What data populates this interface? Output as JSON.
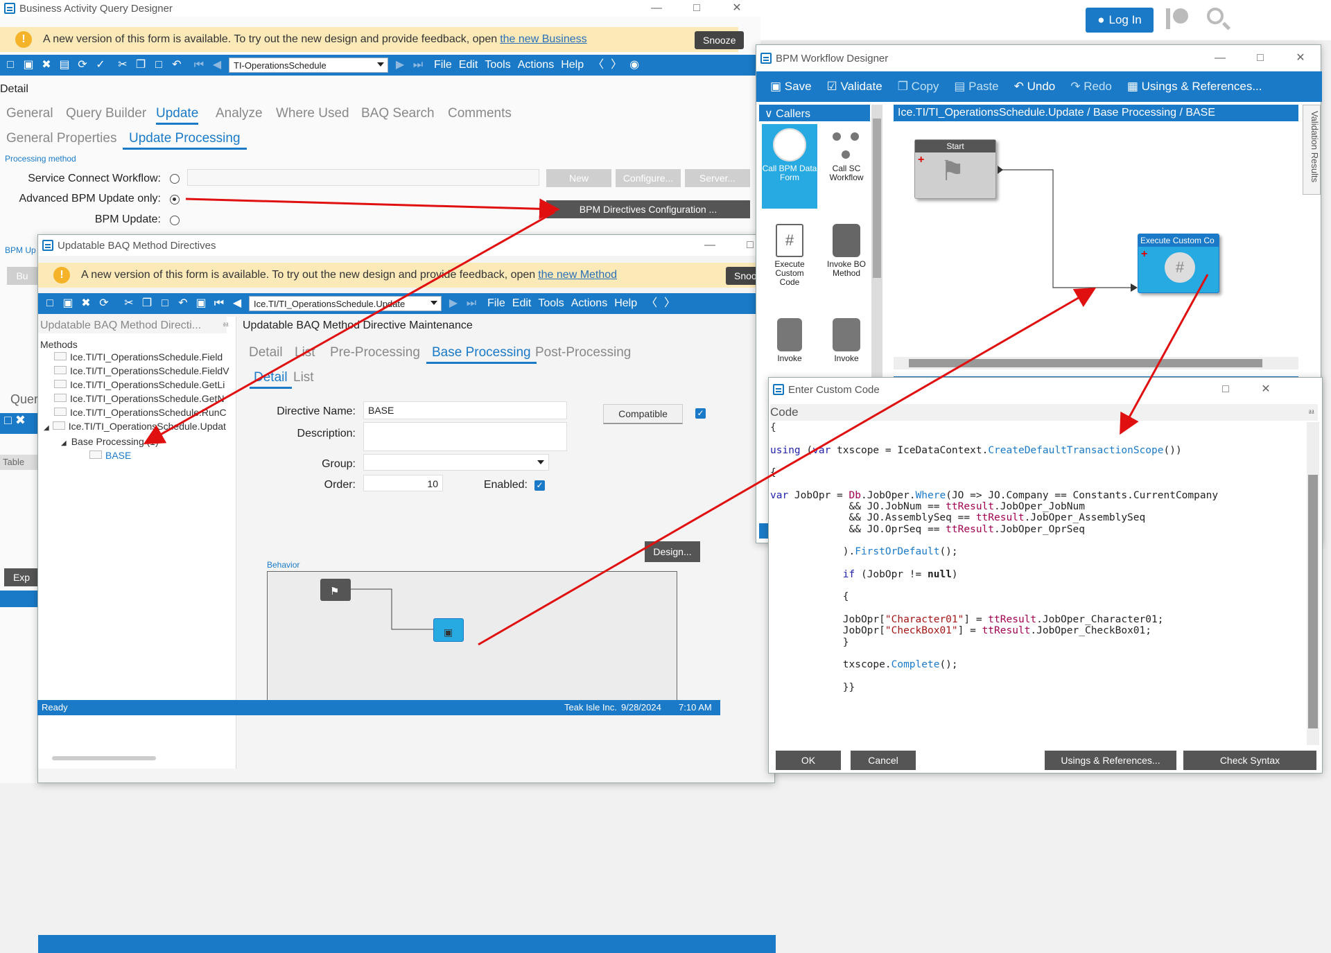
{
  "browser": {
    "login_label": "Log In"
  },
  "baq_designer": {
    "title": "Business Activity Query Designer",
    "banner_text": "A new version of this form is available. To try out the new design and provide feedback, open ",
    "banner_link": "the new Business",
    "snooze_label": "Snooze",
    "combo_value": "TI-OperationsSchedule",
    "menus": [
      "File",
      "Edit",
      "Tools",
      "Actions",
      "Help"
    ],
    "detail_label": "Detail",
    "tabs": [
      "General",
      "Query Builder",
      "Update",
      "Analyze",
      "Where Used",
      "BAQ Search",
      "Comments"
    ],
    "subtabs": [
      "General Properties",
      "Update Processing"
    ],
    "processing_method_label": "Processing method",
    "service_connect_label": "Service Connect Workflow:",
    "advanced_bpm_label": "Advanced BPM Update only:",
    "bpm_update_label": "BPM Update:",
    "new_btn": "New",
    "configure_btn": "Configure...",
    "server_btn": "Server...",
    "bpm_directives_btn": "BPM Directives Configuration ...",
    "bpm_up_label": "BPM Up",
    "bu_btn": "Bu",
    "query_label": "Quer",
    "table_label": "Table",
    "exp_btn": "Exp"
  },
  "directives": {
    "title": "Updatable BAQ Method Directives",
    "banner_text": "A new version of this form is available. To try out the new design and provide feedback, open ",
    "banner_link": "the new Method",
    "snooze_label": "Snoo",
    "combo_value": "Ice.TI/TI_OperationsSchedule.Update",
    "menus": [
      "File",
      "Edit",
      "Tools",
      "Actions",
      "Help"
    ],
    "left_header": "Updatable BAQ Method Directi...",
    "right_header": "Updatable BAQ Method Directive Maintenance",
    "methods_label": "Methods",
    "methods": [
      "Ice.TI/TI_OperationsSchedule.Field",
      "Ice.TI/TI_OperationsSchedule.FieldV",
      "Ice.TI/TI_OperationsSchedule.GetLi",
      "Ice.TI/TI_OperationsSchedule.GetN",
      "Ice.TI/TI_OperationsSchedule.RunC",
      "Ice.TI/TI_OperationsSchedule.Updat"
    ],
    "base_processing_node": "Base Processing (1)",
    "base_node": "BASE",
    "tabs": [
      "Detail",
      "List",
      "Pre-Processing",
      "Base Processing",
      "Post-Processing"
    ],
    "subtabs": [
      "Detail",
      "List"
    ],
    "directive_name_label": "Directive Name:",
    "directive_name_value": "BASE",
    "description_label": "Description:",
    "group_label": "Group:",
    "order_label": "Order:",
    "order_value": "10",
    "enabled_label": "Enabled:",
    "compatible_label": "Compatible",
    "behavior_label": "Behavior",
    "design_btn": "Design...",
    "status_ready": "Ready",
    "status_company": "Teak Isle Inc.",
    "status_date": "9/28/2024",
    "status_time": "7:10 AM"
  },
  "bpm_workflow": {
    "title": "BPM Workflow Designer",
    "toolbar": [
      "Save",
      "Validate",
      "Copy",
      "Paste",
      "Undo",
      "Redo",
      "Usings & References..."
    ],
    "callers_label": "Callers",
    "palette": [
      "Call BPM Data Form",
      "Call SC Workflow",
      "Execute Custom Code",
      "Invoke BO Method",
      "Invoke",
      "Invoke"
    ],
    "path": "Ice.TI/TI_OperationsSchedule.Update / Base Processing / BASE",
    "start_label": "Start",
    "exec_label": "Execute Custom Co",
    "validation_label": "Validation Results"
  },
  "custom_code": {
    "title": "Enter Custom Code",
    "code_label": "Code",
    "ok_btn": "OK",
    "cancel_btn": "Cancel",
    "usings_btn": "Usings & References...",
    "check_syntax_btn": "Check Syntax"
  }
}
